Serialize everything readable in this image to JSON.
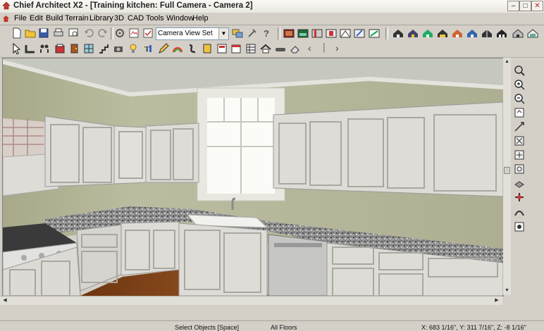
{
  "window": {
    "title": "Chief Architect X2 - [Training kitchen: Full Camera - Camera 2]",
    "minimize": "–",
    "restore": "□",
    "close": "✕"
  },
  "menu": [
    "File",
    "Edit",
    "Build",
    "Terrain",
    "Library",
    "3D",
    "CAD",
    "Tools",
    "Window",
    "Help"
  ],
  "toolbar": {
    "camera_view_set": "Camera View Set",
    "combo_arrow": "▼",
    "nav_prev": "‹",
    "nav_mid": "│",
    "nav_next": "›"
  },
  "scroll": {
    "up": "▲",
    "down": "▼",
    "left": "◀",
    "right": "▶"
  },
  "statusbar": {
    "mode": "Select Objects [Space]",
    "floor": "All Floors",
    "coords": "X: 683 1/16\", Y: 311 7/16\", Z: -8 1/16\""
  },
  "colors": {
    "wall": "#b1b093",
    "ceiling": "#c9cac2",
    "cabinet": "#dedcd6",
    "countertop": "#7a7a7a",
    "floor": "#8a4a1e",
    "chrome": "#d4d0c8"
  }
}
